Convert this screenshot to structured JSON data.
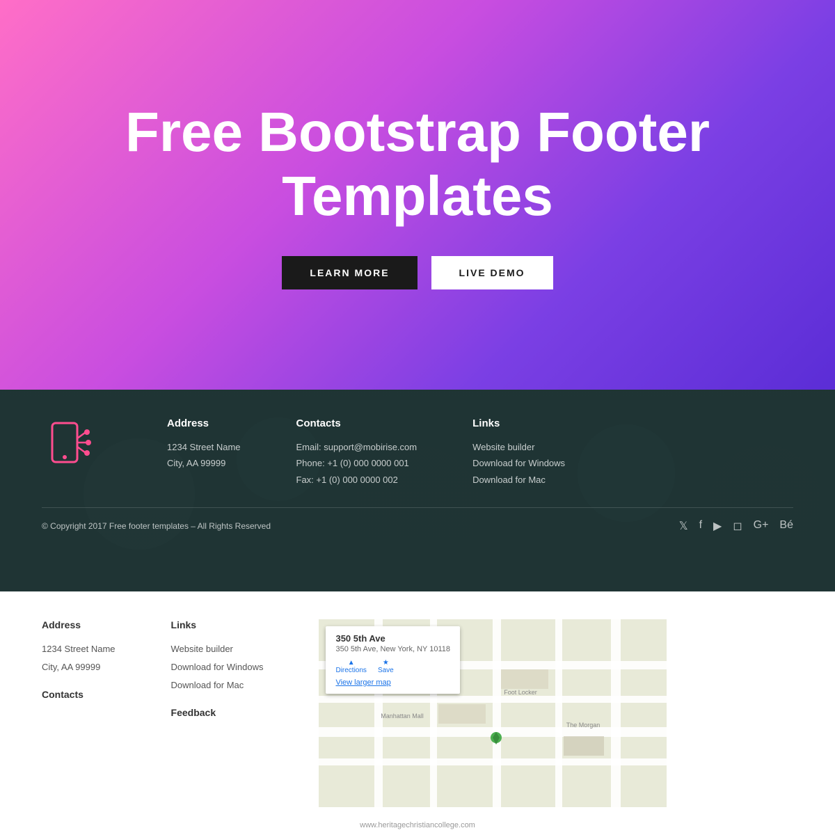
{
  "hero": {
    "title": "Free Bootstrap Footer Templates",
    "btn_learn": "LEARN MORE",
    "btn_demo": "LIVE DEMO"
  },
  "footer_dark": {
    "address_heading": "Address",
    "address_line1": "1234 Street Name",
    "address_line2": "City, AA 99999",
    "contacts_heading": "Contacts",
    "contact_email": "Email: support@mobirise.com",
    "contact_phone": "Phone: +1 (0) 000 0000 001",
    "contact_fax": "Fax: +1 (0) 000 0000 002",
    "links_heading": "Links",
    "link1": "Website builder",
    "link2": "Download for Windows",
    "link3": "Download for Mac",
    "copyright": "© Copyright 2017 Free footer templates – All Rights Reserved",
    "social_icons": [
      "twitter",
      "facebook",
      "youtube",
      "instagram",
      "google-plus",
      "behance"
    ]
  },
  "footer_light": {
    "address_heading": "Address",
    "address_line1": "1234 Street Name",
    "address_line2": "City, AA 99999",
    "links_heading": "Links",
    "link1": "Website builder",
    "link2": "Download for Windows",
    "link3": "Download for Mac",
    "contacts_heading": "Contacts",
    "feedback_heading": "Feedback",
    "map_address_title": "350 5th Ave",
    "map_address_sub": "350 5th Ave, New York, NY 10118",
    "map_link": "View larger map",
    "website_url": "www.heritagechristiancollege.com"
  }
}
